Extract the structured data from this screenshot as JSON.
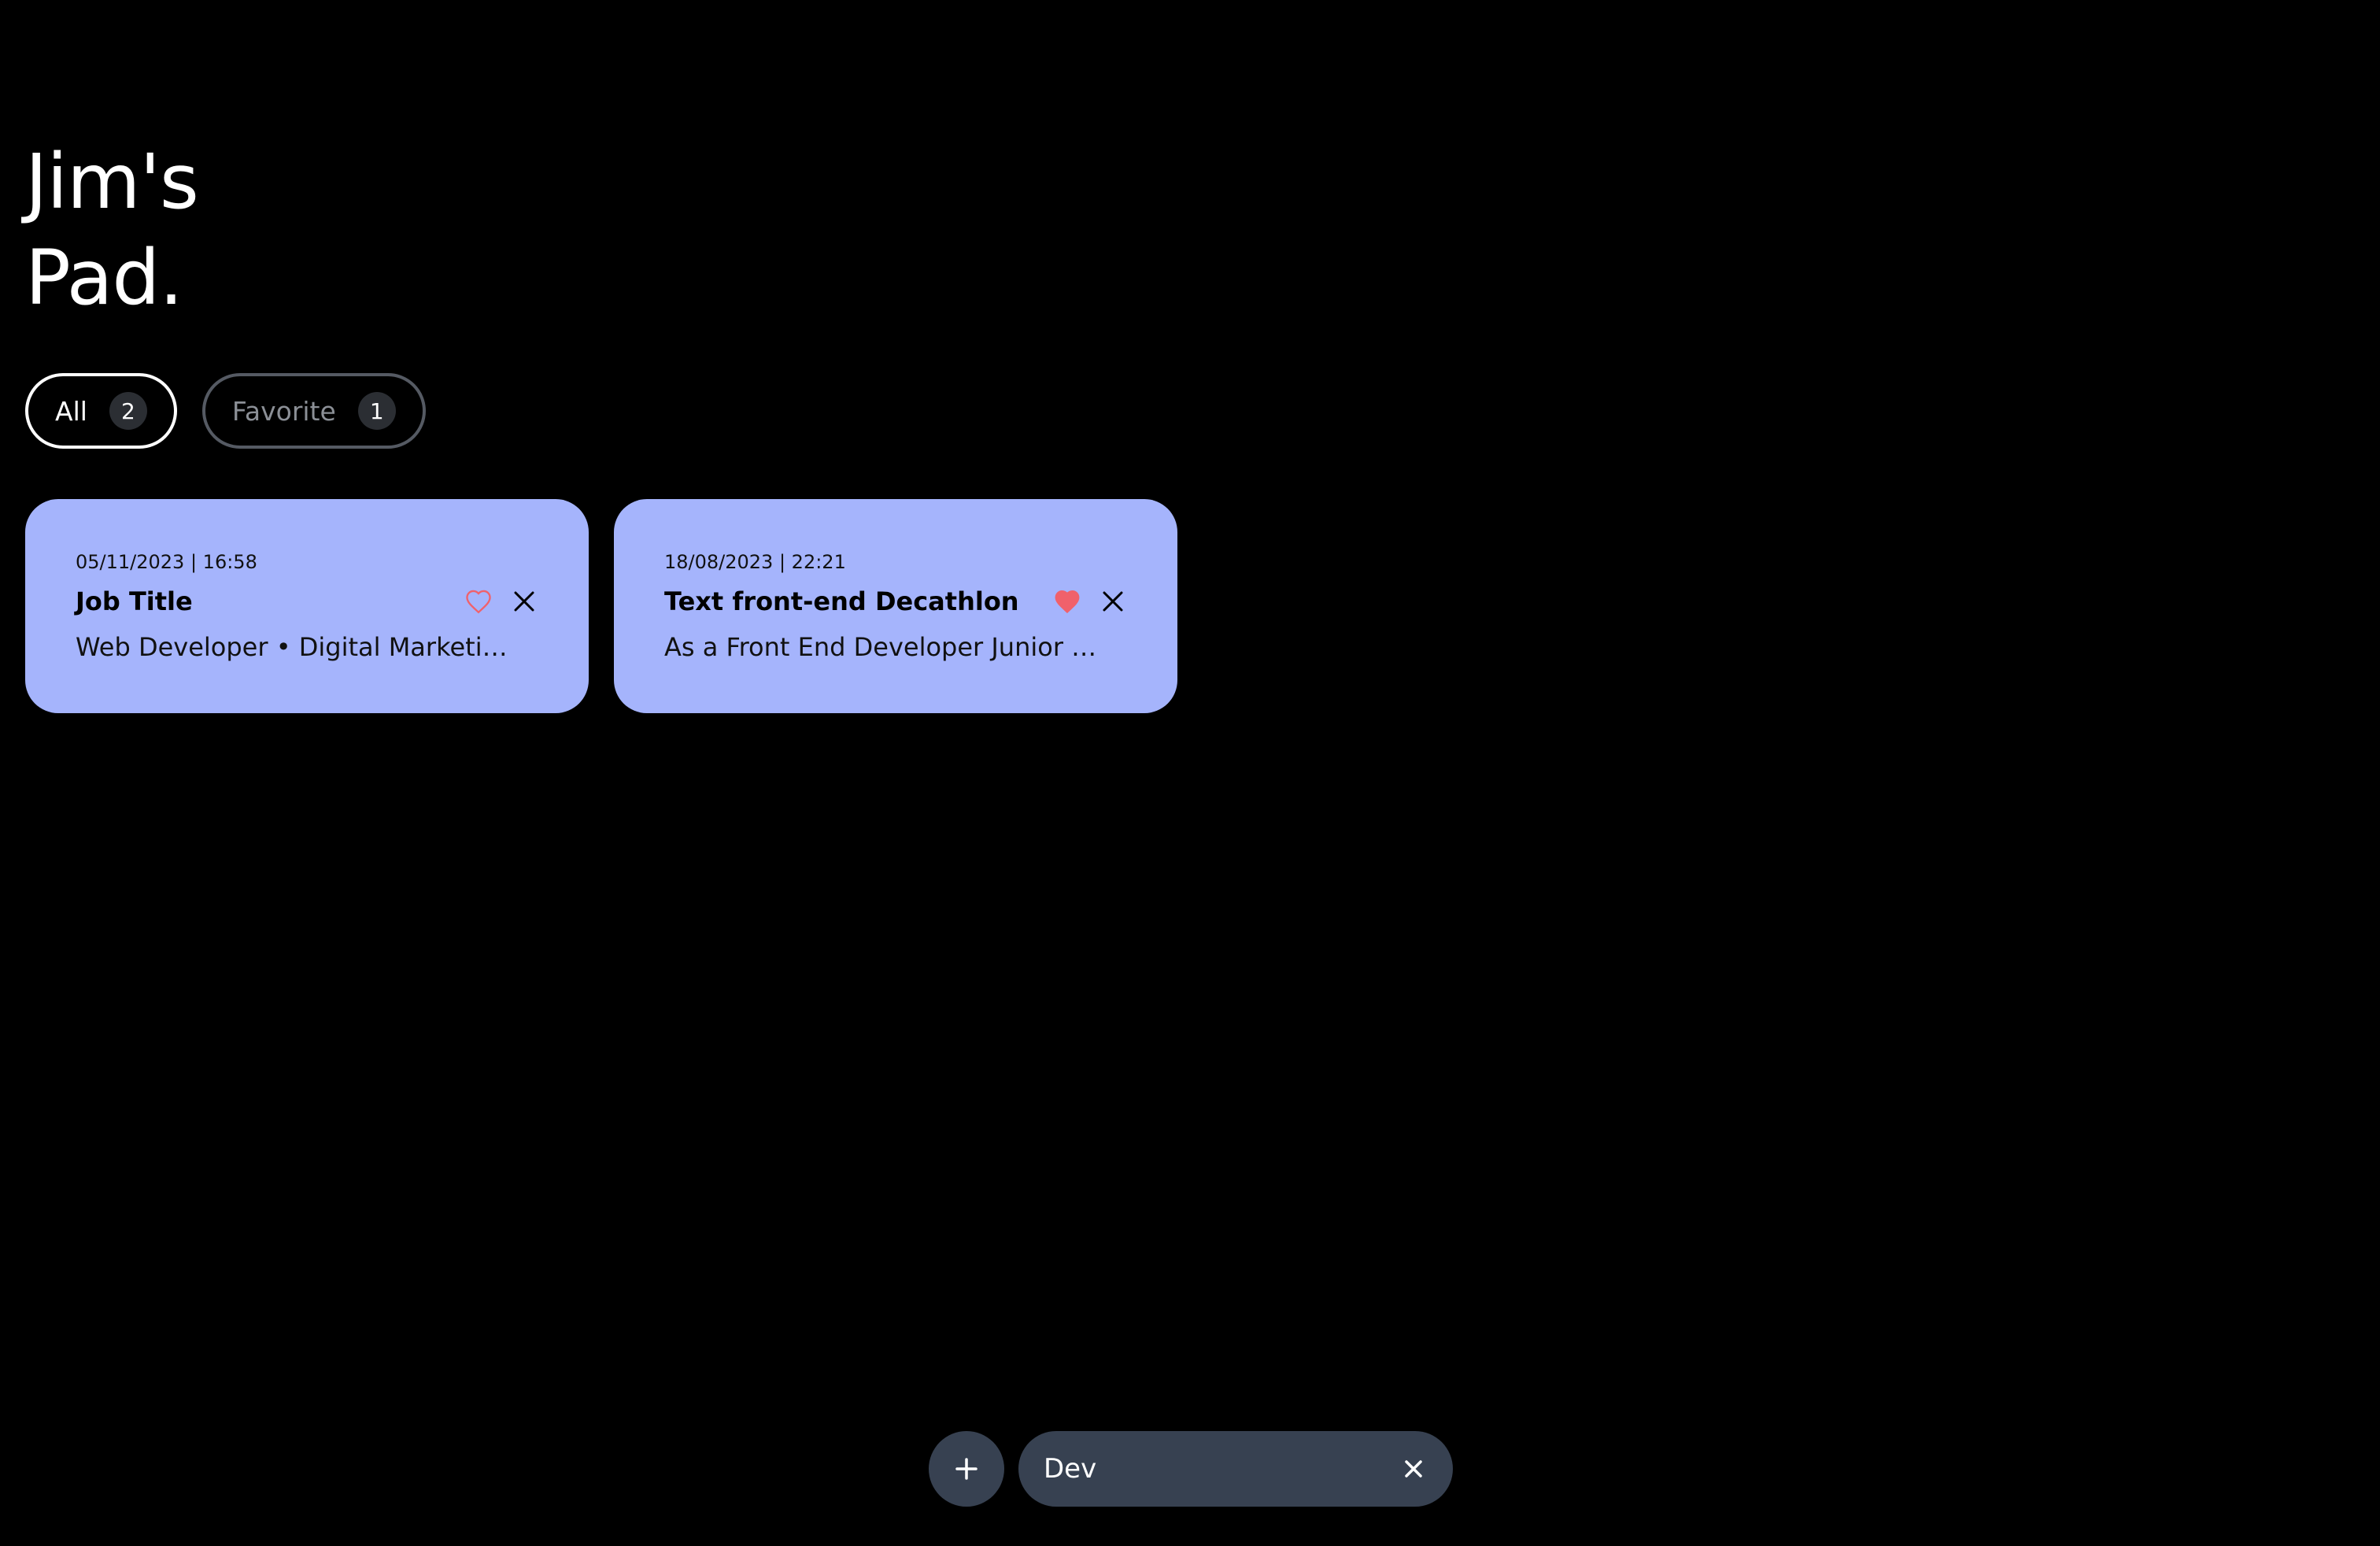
{
  "app": {
    "title_line1": "Jim's",
    "title_line2": "Pad."
  },
  "filters": [
    {
      "label": "All",
      "count": "2",
      "active": true
    },
    {
      "label": "Favorite",
      "count": "1",
      "active": false
    }
  ],
  "notes": [
    {
      "date": "05/11/2023 | 16:58",
      "title": "Job Title",
      "description": "Web Developer • Digital Marketing...",
      "favorite": false
    },
    {
      "date": "18/08/2023 | 22:21",
      "title": "Text front-end Decathlon",
      "description": "As a Front End Developer Junior at...",
      "favorite": true
    }
  ],
  "search": {
    "value": "Dev",
    "placeholder": ""
  },
  "icons": {
    "add": "plus-icon",
    "clear": "close-icon",
    "favorite": "heart-icon",
    "delete": "close-icon"
  },
  "colors": {
    "background": "#000000",
    "card": "#a5b4fc",
    "heart": "#f0616b",
    "control": "#374151"
  }
}
